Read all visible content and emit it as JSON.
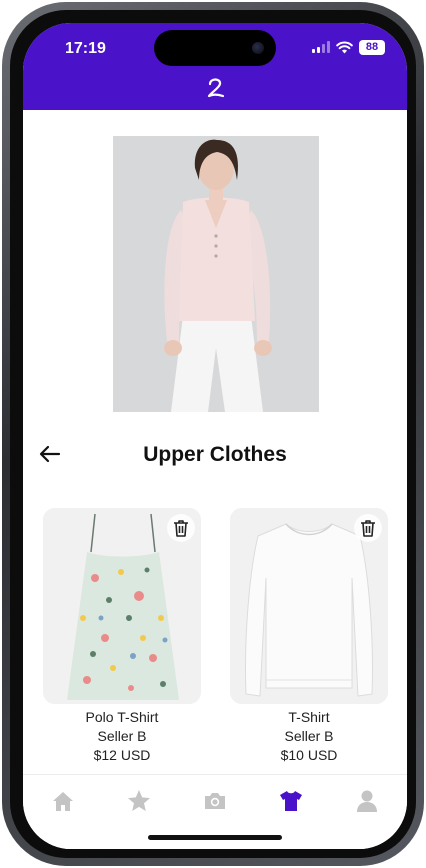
{
  "status_bar": {
    "time": "17:19",
    "battery": "88"
  },
  "page": {
    "title": "Upper Clothes"
  },
  "products": [
    {
      "name": "Polo T-Shirt",
      "seller": "Seller B",
      "price": "$12 USD"
    },
    {
      "name": "T-Shirt",
      "seller": "Seller B",
      "price": "$10 USD"
    }
  ],
  "tabs": [
    {
      "icon": "home-icon",
      "active": false
    },
    {
      "icon": "star-icon",
      "active": false
    },
    {
      "icon": "camera-icon",
      "active": false
    },
    {
      "icon": "shirt-icon",
      "active": true
    },
    {
      "icon": "person-icon",
      "active": false
    }
  ],
  "colors": {
    "brand": "#4a12c9",
    "tab_inactive": "#c4c4c4",
    "tab_active": "#4a12c9"
  }
}
